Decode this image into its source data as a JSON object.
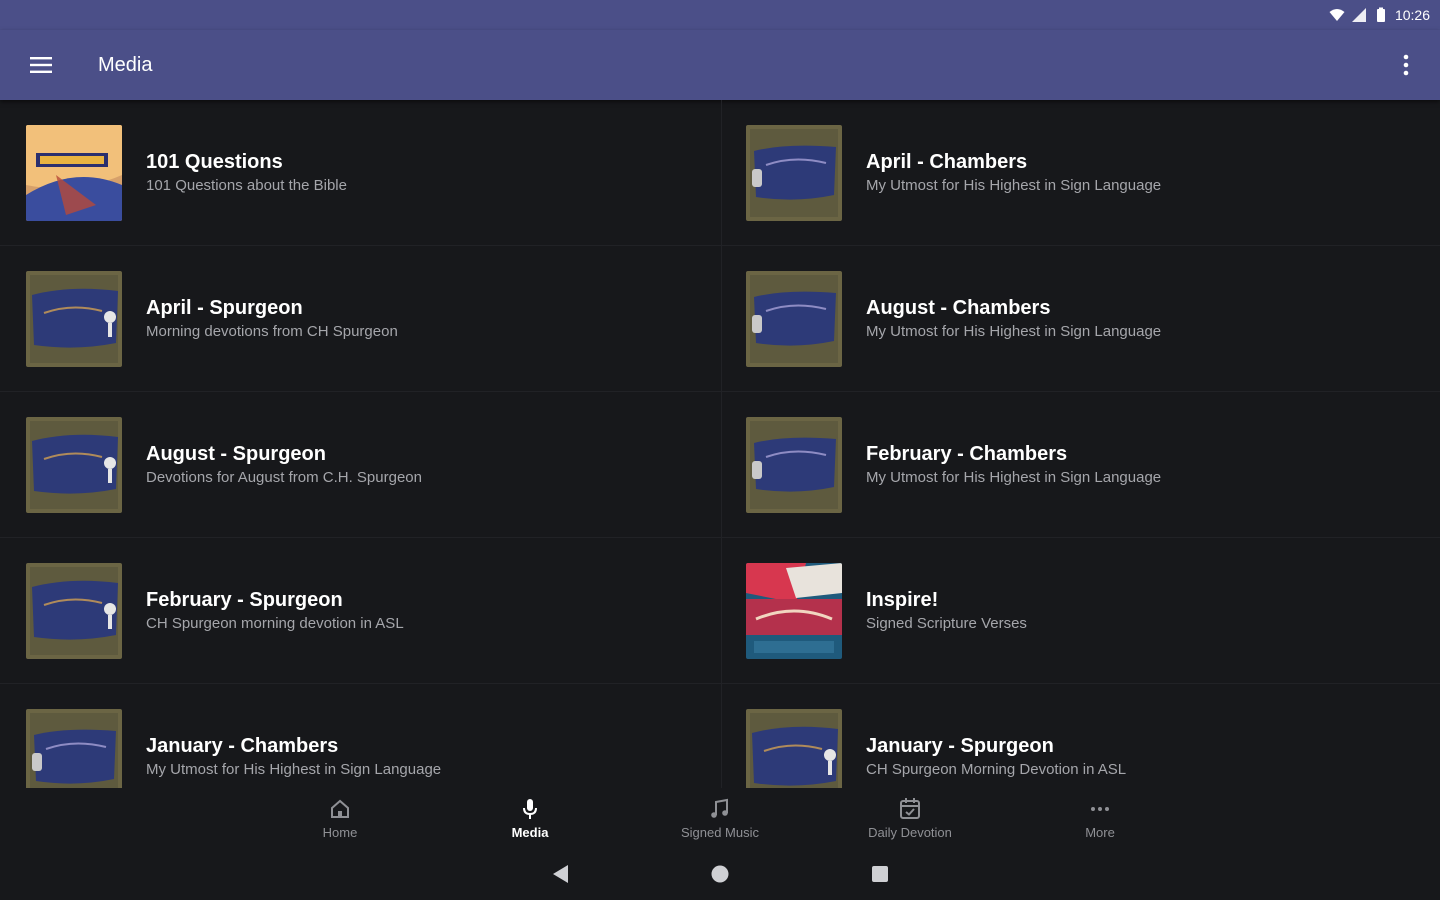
{
  "status": {
    "time": "10:26"
  },
  "appbar": {
    "title": "Media"
  },
  "colors": {
    "primary": "#4b4f88",
    "background": "#17181b",
    "subtitle": "#a5a6ab",
    "nav_inactive": "#8f9095"
  },
  "items": [
    {
      "title": "101 Questions",
      "subtitle": "101 Questions about the Bible",
      "thumb": "questions"
    },
    {
      "title": "April - Chambers",
      "subtitle": "My Utmost for His Highest in Sign Language",
      "thumb": "chambers"
    },
    {
      "title": "April - Spurgeon",
      "subtitle": "Morning devotions from CH Spurgeon",
      "thumb": "spurgeon"
    },
    {
      "title": "August - Chambers",
      "subtitle": "My Utmost for His Highest in Sign Language",
      "thumb": "chambers"
    },
    {
      "title": "August - Spurgeon",
      "subtitle": "Devotions for August from C.H. Spurgeon",
      "thumb": "spurgeon"
    },
    {
      "title": "February - Chambers",
      "subtitle": "My Utmost for His Highest in Sign Language",
      "thumb": "chambers"
    },
    {
      "title": "February - Spurgeon",
      "subtitle": "CH Spurgeon morning devotion in ASL",
      "thumb": "spurgeon"
    },
    {
      "title": "Inspire!",
      "subtitle": "Signed Scripture Verses",
      "thumb": "inspire"
    },
    {
      "title": "January - Chambers",
      "subtitle": "My Utmost for His Highest in Sign Language",
      "thumb": "chambers"
    },
    {
      "title": "January - Spurgeon",
      "subtitle": "CH Spurgeon Morning Devotion in ASL",
      "thumb": "spurgeon"
    }
  ],
  "bottom_nav": [
    {
      "label": "Home",
      "icon": "home-icon",
      "active": false
    },
    {
      "label": "Media",
      "icon": "microphone-icon",
      "active": true
    },
    {
      "label": "Signed Music",
      "icon": "music-note-icon",
      "active": false
    },
    {
      "label": "Daily Devotion",
      "icon": "calendar-icon",
      "active": false
    },
    {
      "label": "More",
      "icon": "more-horizontal-icon",
      "active": false
    }
  ]
}
